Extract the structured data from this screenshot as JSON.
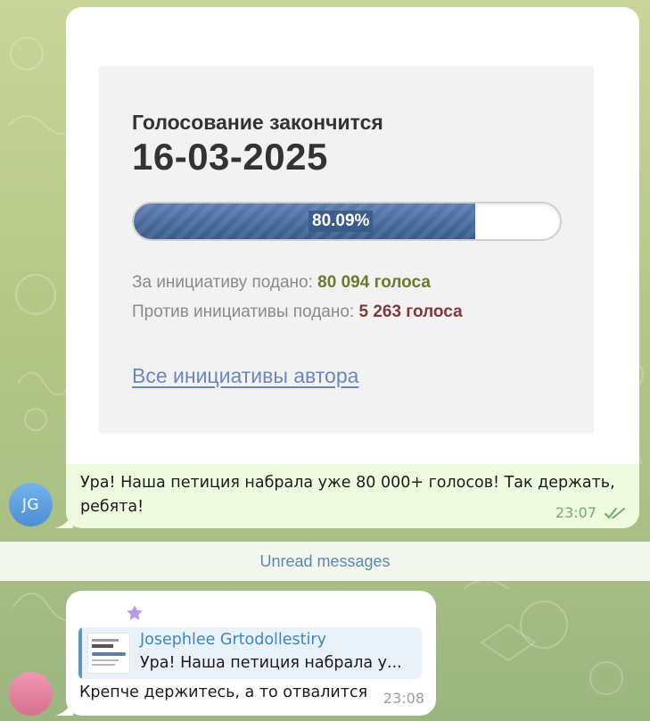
{
  "messages": [
    {
      "avatar_initials": "JG",
      "image_card": {
        "title": "Голосование закончится",
        "date": "16-03-2025",
        "progress_label": "80.09%",
        "progress_value": 0.8009,
        "for_label": "За инициативу подано:",
        "for_value": "80 094 голоса",
        "against_label": "Против инициативы подано:",
        "against_value": "5 263 голоса",
        "link_text": "Все инициативы автора"
      },
      "caption": "Ура! Наша петиция набрала уже  80 000+ голосов! Так держать, ребята!",
      "time": "23:07",
      "status_icon": "double-check-icon"
    },
    {
      "reaction_icon": "star-icon",
      "reply": {
        "author": "Josephlee Grtodollestiry",
        "preview": "Ура! Наша петиция набрала у..."
      },
      "text": "Крепче держитесь, а то отвалится",
      "time": "23:08"
    }
  ],
  "unread_divider": "Unread messages",
  "colors": {
    "outgoing_bubble": "#eefbdf",
    "incoming_bubble": "#ffffff",
    "link": "#3f86bf",
    "progress_fill": "#47699c",
    "for_votes": "#6b7a2e",
    "against_votes": "#7d3b3b"
  }
}
